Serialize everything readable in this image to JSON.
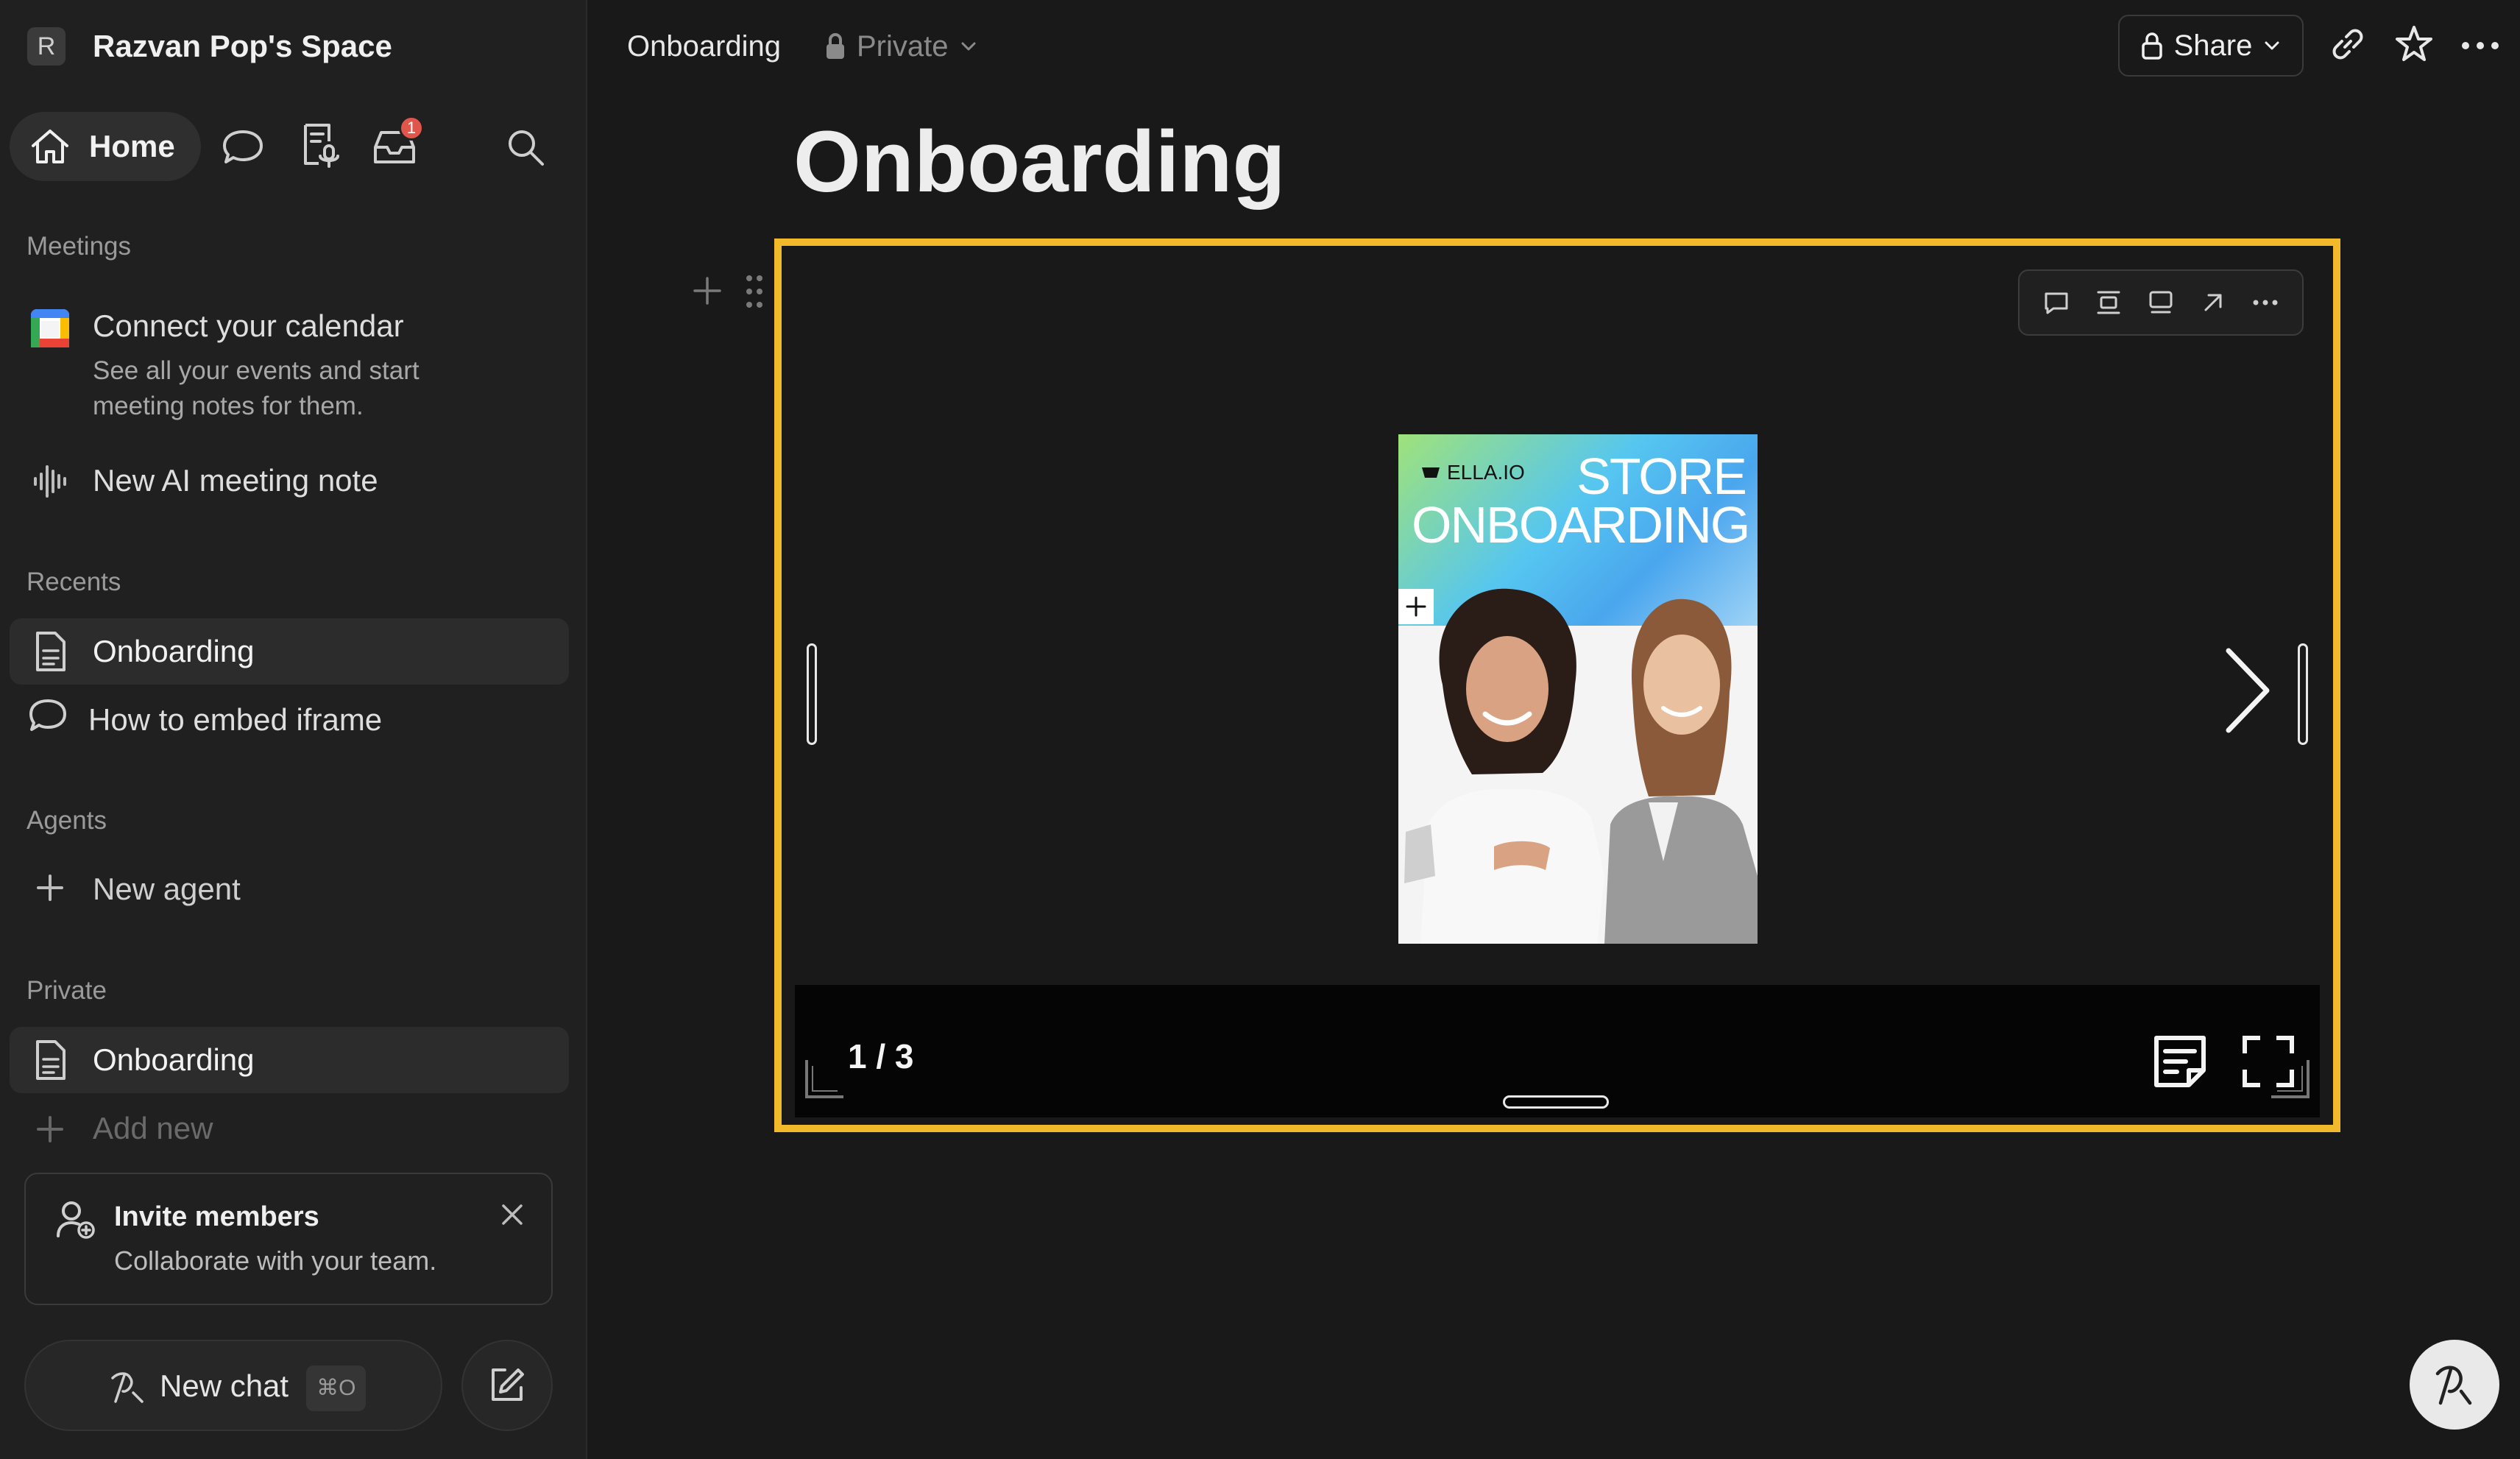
{
  "workspace": {
    "initial": "R",
    "name": "Razvan Pop's Space"
  },
  "nav": {
    "home_label": "Home",
    "inbox_badge": "1"
  },
  "meetings": {
    "section": "Meetings",
    "connect_title": "Connect your calendar",
    "connect_sub_1": "See all your events and start",
    "connect_sub_2": "meeting notes for them.",
    "ai_note": "New AI meeting note"
  },
  "recents": {
    "section": "Recents",
    "items": [
      {
        "label": "Onboarding"
      },
      {
        "label": "How to embed iframe"
      }
    ]
  },
  "agents": {
    "section": "Agents",
    "new_agent": "New agent"
  },
  "private": {
    "section": "Private",
    "items": [
      {
        "label": "Onboarding"
      }
    ],
    "add_new": "Add new"
  },
  "invite": {
    "title": "Invite members",
    "subtitle": "Collaborate with your team."
  },
  "chat": {
    "new_chat": "New chat",
    "shortcut": "⌘O"
  },
  "topbar": {
    "breadcrumb": "Onboarding",
    "privacy": "Private",
    "share_label": "Share"
  },
  "page": {
    "title": "Onboarding"
  },
  "embed": {
    "slide_brand": "ELLA.IO",
    "slide_title_1": "STORE",
    "slide_title_2": "ONBOARDING",
    "counter": "1 / 3",
    "accent": "#f2b92a"
  },
  "colors": {
    "background": "#191919",
    "sidebar": "#202020",
    "badge": "#e0564b"
  }
}
